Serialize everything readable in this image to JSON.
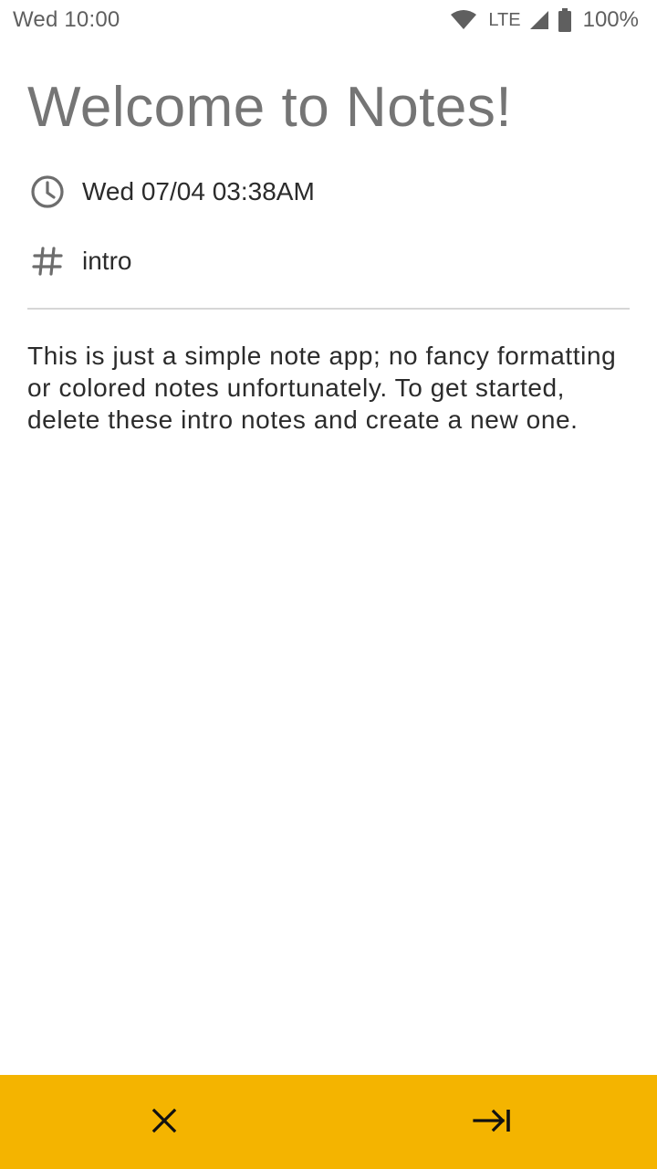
{
  "status_bar": {
    "time": "Wed 10:00",
    "network": "LTE",
    "battery": "100%",
    "icons": [
      "wifi-icon",
      "signal-icon",
      "battery-icon"
    ]
  },
  "note": {
    "title": "Welcome to Notes!",
    "date": "Wed 07/04 03:38AM",
    "tag": "intro",
    "body": "This is just a simple note app; no fancy formatting or colored notes unfortunately. To get started, delete these intro notes and create a new one."
  },
  "bottom_bar": {
    "color": "#f4b400",
    "buttons": [
      "close-icon",
      "skip-next-icon"
    ]
  },
  "colors": {
    "title": "#757575",
    "text": "#2b2b2b",
    "status": "#5f5f5f"
  }
}
